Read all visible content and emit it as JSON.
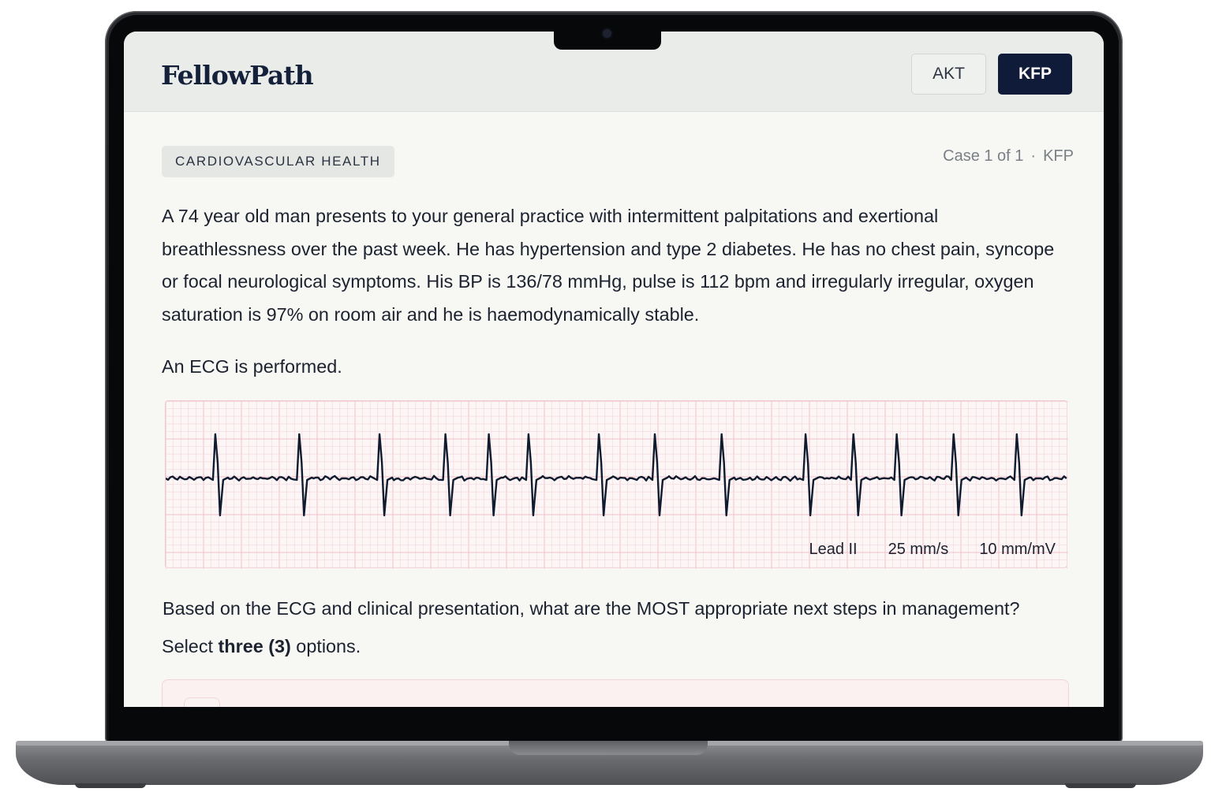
{
  "header": {
    "logo": "FellowPath",
    "modes": [
      {
        "label": "AKT",
        "active": false
      },
      {
        "label": "KFP",
        "active": true
      }
    ]
  },
  "case": {
    "category": "CARDIOVASCULAR HEALTH",
    "meta_position": "Case 1 of 1",
    "meta_separator": "·",
    "meta_exam": "KFP",
    "vignette": "A 74 year old man presents to your general practice with intermittent palpitations and exertional breathlessness over the past week. He has hypertension and type 2 diabetes. He has no chest pain, syncope or focal neurological symptoms. His BP is 136/78 mmHg, pulse is 112 bpm and irregularly irregular, oxygen saturation is 97% on room air and he is haemodynamically stable.",
    "ecg_intro": "An ECG is performed."
  },
  "ecg": {
    "lead": "Lead II",
    "paper_speed": "25 mm/s",
    "gain": "10 mm/mV",
    "beats": [
      0.055,
      0.148,
      0.237,
      0.31,
      0.358,
      0.402,
      0.48,
      0.542,
      0.616,
      0.709,
      0.762,
      0.81,
      0.873,
      0.943
    ]
  },
  "question": {
    "prompt": "Based on the ECG and clinical presentation, what are the MOST appropriate next steps in management?",
    "instruction_prefix": "Select ",
    "instruction_bold": "three (3)",
    "instruction_suffix": " options."
  },
  "colors": {
    "brand_navy": "#0f1b38",
    "ecg_grid_minor": "#f6dde0",
    "ecg_grid_major": "#efc3c9",
    "ecg_trace": "#0f1b2e"
  }
}
